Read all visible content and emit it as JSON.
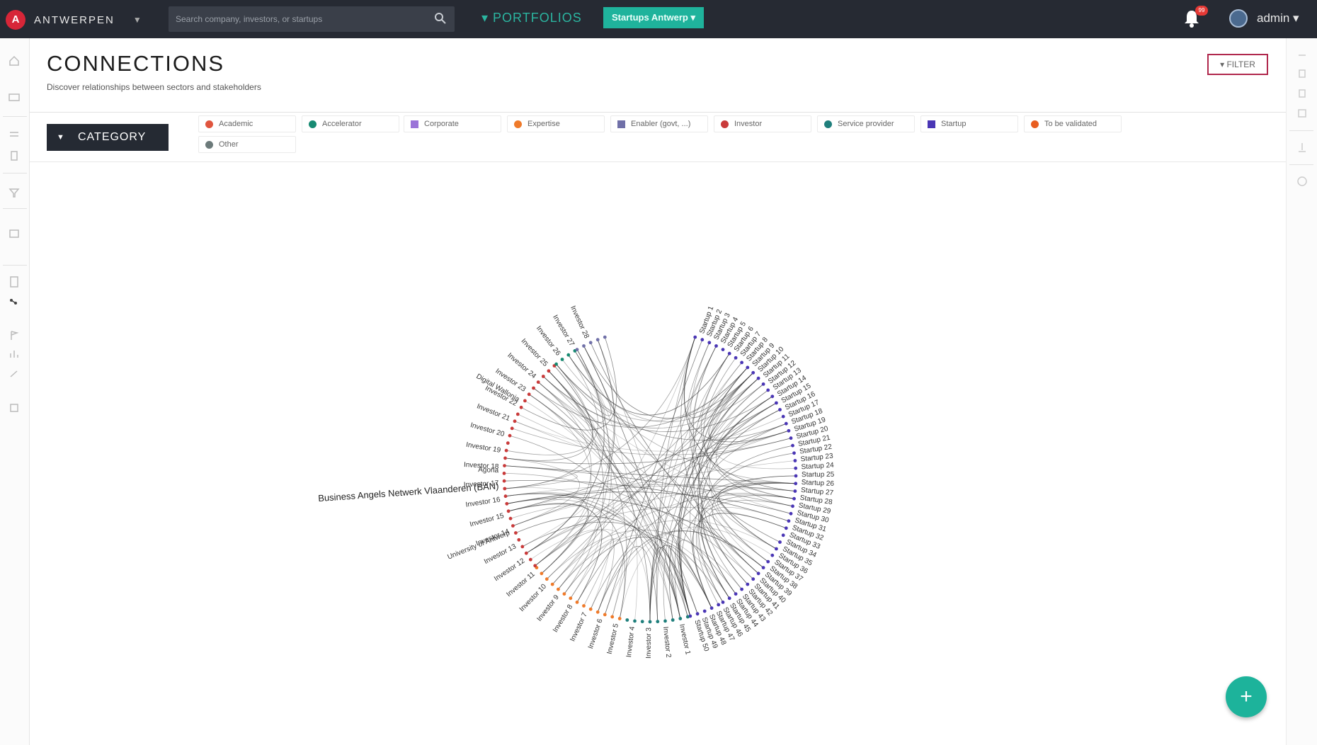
{
  "topbar": {
    "brand": "ANTWERPEN",
    "search_placeholder": "Search company, investors, or startups",
    "portfolios_label": "PORTFOLIOS",
    "portfolio_selected": "Startups Antwerp",
    "notification_count": "99",
    "user_name": "admin"
  },
  "page": {
    "title": "CONNECTIONS",
    "subtitle": "Discover relationships between sectors and stakeholders",
    "filter_label": "FILTER"
  },
  "category_label": "CATEGORY",
  "legend": [
    {
      "label": "Academic",
      "color": "#e0553e"
    },
    {
      "label": "Accelerator",
      "color": "#178a72"
    },
    {
      "label": "Corporate",
      "color": "#9b74d8"
    },
    {
      "label": "Expertise",
      "color": "#ef7a2a"
    },
    {
      "label": "Enabler (govt, ...)",
      "color": "#7070a8"
    },
    {
      "label": "Investor",
      "color": "#c93a3a"
    },
    {
      "label": "Service provider",
      "color": "#1f7f7c"
    },
    {
      "label": "Startup",
      "color": "#4a36b5"
    },
    {
      "label": "To be validated",
      "color": "#e85d20"
    },
    {
      "label": "Other",
      "color": "#6c7a7a"
    }
  ],
  "node_labels": {
    "startups": [
      "Startup 1",
      "Startup 2",
      "Startup 3",
      "Startup 4",
      "Startup 5",
      "Startup 6",
      "Startup 7",
      "Startup 8",
      "Startup 9",
      "Startup 10",
      "Startup 11",
      "Startup 12",
      "Startup 13",
      "Startup 14",
      "Startup 15",
      "Startup 16",
      "Startup 17",
      "Startup 18",
      "Startup 19",
      "Startup 20",
      "Startup 21",
      "Startup 22",
      "Startup 23",
      "Startup 24",
      "Startup 25",
      "Startup 26",
      "Startup 27",
      "Startup 28",
      "Startup 29",
      "Startup 30",
      "Startup 31",
      "Startup 32",
      "Startup 33",
      "Startup 34",
      "Startup 35",
      "Startup 36",
      "Startup 37",
      "Startup 38",
      "Startup 39",
      "Startup 40",
      "Startup 41",
      "Startup 42",
      "Startup 43",
      "Startup 44",
      "Startup 45",
      "Startup 46",
      "Startup 47",
      "Startup 48",
      "Startup 49",
      "Startup 50"
    ],
    "investors": [
      "Investor 1",
      "Investor 2",
      "Investor 3",
      "Investor 4",
      "Investor 5",
      "Investor 6",
      "Investor 7",
      "Investor 8",
      "Investor 9",
      "Investor 10",
      "Investor 11",
      "Investor 12",
      "Investor 13",
      "Investor 14",
      "Investor 15",
      "Investor 16",
      "Investor 17",
      "Investor 18",
      "Investor 19",
      "Investor 20",
      "Investor 21",
      "Investor 22",
      "Investor 23",
      "Investor 24",
      "Investor 25",
      "Investor 26",
      "Investor 27",
      "Investor 28"
    ],
    "highlighted": [
      "Business Angels Netwerk Vlaanderen (BAN)",
      "University of Antwerp",
      "Digital Wallonia",
      "Agoria"
    ]
  }
}
